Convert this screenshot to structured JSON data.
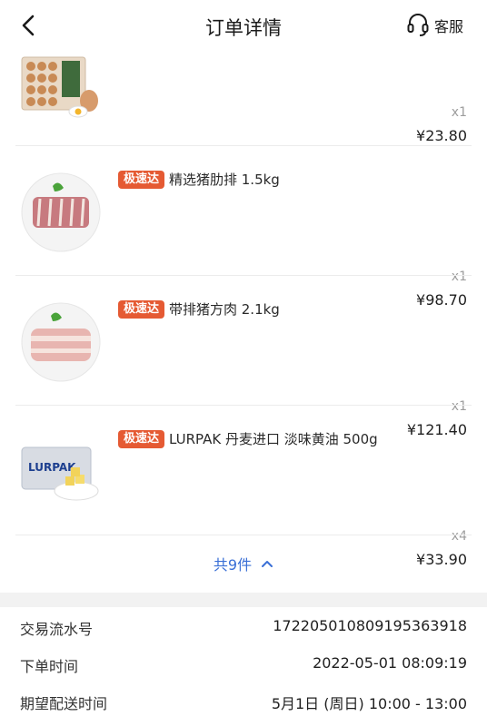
{
  "header": {
    "title": "订单详情",
    "service_label": "客服"
  },
  "items": [
    {
      "badge": "",
      "name": "",
      "qty": "x1",
      "price": "¥23.80",
      "icon": "eggs-icon"
    },
    {
      "badge": "极速达",
      "name": "精选猪肋排 1.5kg",
      "qty": "x1",
      "price": "¥98.70",
      "icon": "pork-ribs-icon"
    },
    {
      "badge": "极速达",
      "name": "带排猪方肉 2.1kg",
      "qty": "x1",
      "price": "¥121.40",
      "icon": "pork-belly-icon"
    },
    {
      "badge": "极速达",
      "name": "LURPAK 丹麦进口 淡味黄油 500g",
      "qty": "x4",
      "price": "¥33.90",
      "icon": "butter-icon",
      "brand_text": "LURPAK"
    }
  ],
  "more": {
    "label": "共9件"
  },
  "info": [
    {
      "key": "交易流水号",
      "value": "17220501080919536391​8"
    },
    {
      "key": "下单时间",
      "value": "2022-05-01 08:09:19"
    },
    {
      "key": "期望配送时间",
      "value": "5月1日 (周日) 10:00 - 13:00"
    }
  ],
  "colors": {
    "badge": "#e55a33",
    "link": "#3a6fd6",
    "divider": "#ececec",
    "section_gap": "#f2f2f2"
  }
}
